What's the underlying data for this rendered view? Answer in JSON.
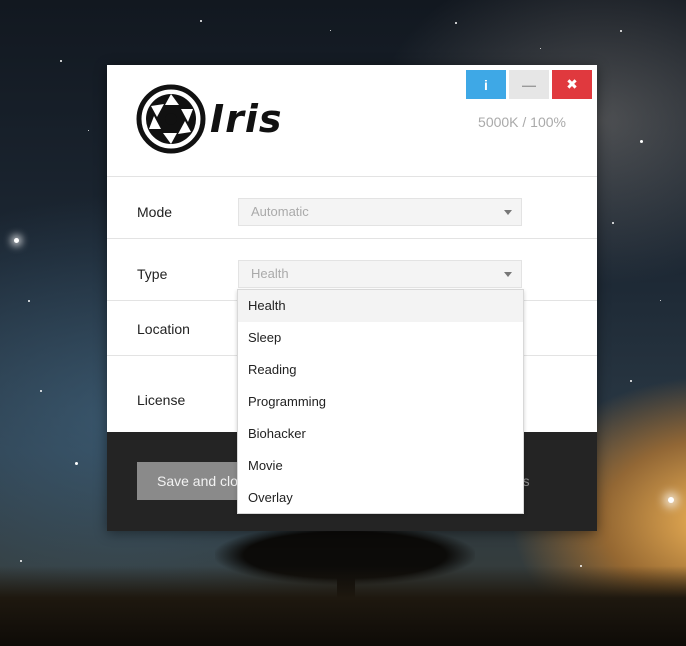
{
  "app": {
    "name": "Iris",
    "status": "5000K / 100%"
  },
  "window_controls": {
    "info_label": "i",
    "minimize_label": "—",
    "close_label": "✖"
  },
  "form": {
    "mode": {
      "label": "Mode",
      "value": "Automatic"
    },
    "type": {
      "label": "Type",
      "value": "Health"
    },
    "location": {
      "label": "Location"
    },
    "license": {
      "label": "License"
    }
  },
  "footer": {
    "save_label": "Save and clo",
    "settings_label": "ngs"
  },
  "dropdown": {
    "options": [
      "Health",
      "Sleep",
      "Reading",
      "Programming",
      "Biohacker",
      "Movie",
      "Overlay"
    ],
    "selected": "Health"
  },
  "icons": [
    "aperture-logo-icon",
    "info-icon",
    "minimize-icon",
    "close-icon",
    "chevron-down-icon"
  ]
}
